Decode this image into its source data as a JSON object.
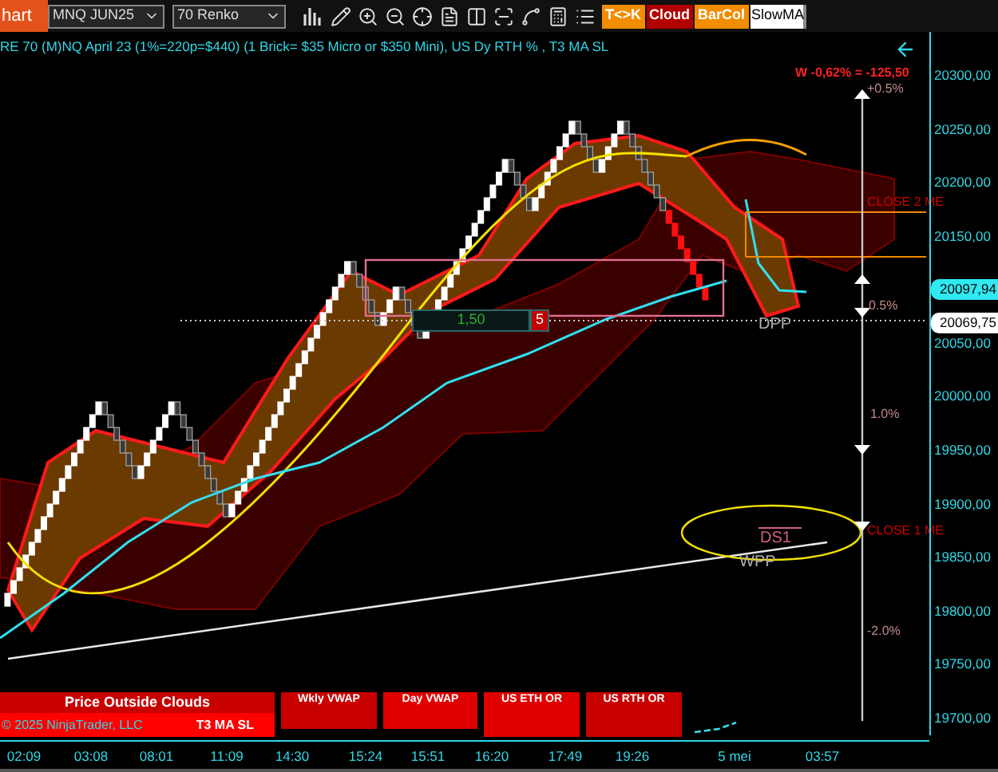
{
  "toolbar": {
    "tab": "hart",
    "instrument": "MNQ JUN25",
    "interval": "70 Renko",
    "buttons": [
      {
        "label": "T<>K",
        "color": "#f28c00"
      },
      {
        "label": "Cloud",
        "color": "#b00000"
      },
      {
        "label": "BarCol",
        "color": "#f28c00"
      }
    ],
    "indicator_field": {
      "value": "SlowMA"
    }
  },
  "chart": {
    "title": "RE 70 (M)NQ April 23 (1%=220p=$440) (1 Brick= $35 Micro or $350 Mini), US Dy RTH % , T3 MA SL",
    "annotations": [
      {
        "text": "W -0,62% = -125,50",
        "kind": "loss"
      },
      {
        "text": "+0.5%",
        "kind": "percent"
      },
      {
        "text": "CLOSE 2 ME",
        "kind": "close"
      },
      {
        "text": "0.5%",
        "kind": "percent"
      },
      {
        "text": "1.0%",
        "kind": "percent"
      },
      {
        "text": "CLOSE 1 ME",
        "kind": "close"
      },
      {
        "text": "-2.0%",
        "kind": "percent"
      },
      {
        "text": "DPP",
        "kind": "pivot"
      },
      {
        "text": "DS1",
        "kind": "support"
      },
      {
        "text": "WPP",
        "kind": "pivot"
      }
    ],
    "position_box": {
      "value": "1,50",
      "count": "5"
    },
    "price_axis": [
      "20300,00",
      "20250,00",
      "20200,00",
      "20150,00",
      "20050,00",
      "20000,00",
      "19950,00",
      "19900,00",
      "19850,00",
      "19800,00",
      "19750,00",
      "19700,00"
    ],
    "price_badges": [
      {
        "label": "20097,94",
        "kind": "last"
      },
      {
        "label": "20069,75",
        "kind": "marker"
      }
    ],
    "time_axis": [
      "02:09",
      "03:08",
      "08:01",
      "11:09",
      "14:30",
      "15:24",
      "15:51",
      "16:20",
      "17:49",
      "19:26",
      "5 mei",
      "03:57"
    ],
    "indicator_panels": [
      {
        "label": "Price Outside Clouds",
        "sublabel": "T3 MA SL",
        "color": "#c80000"
      },
      {
        "label": "Wkly VWAP",
        "color": "#c80000"
      },
      {
        "label": "Day VWAP",
        "color": "#e00000"
      },
      {
        "label": "US ETH OR",
        "color": "#e00000"
      },
      {
        "label": "US RTH OR",
        "color": "#c80000"
      }
    ],
    "copyright": "© 2025 NinjaTrader, LLC"
  }
}
